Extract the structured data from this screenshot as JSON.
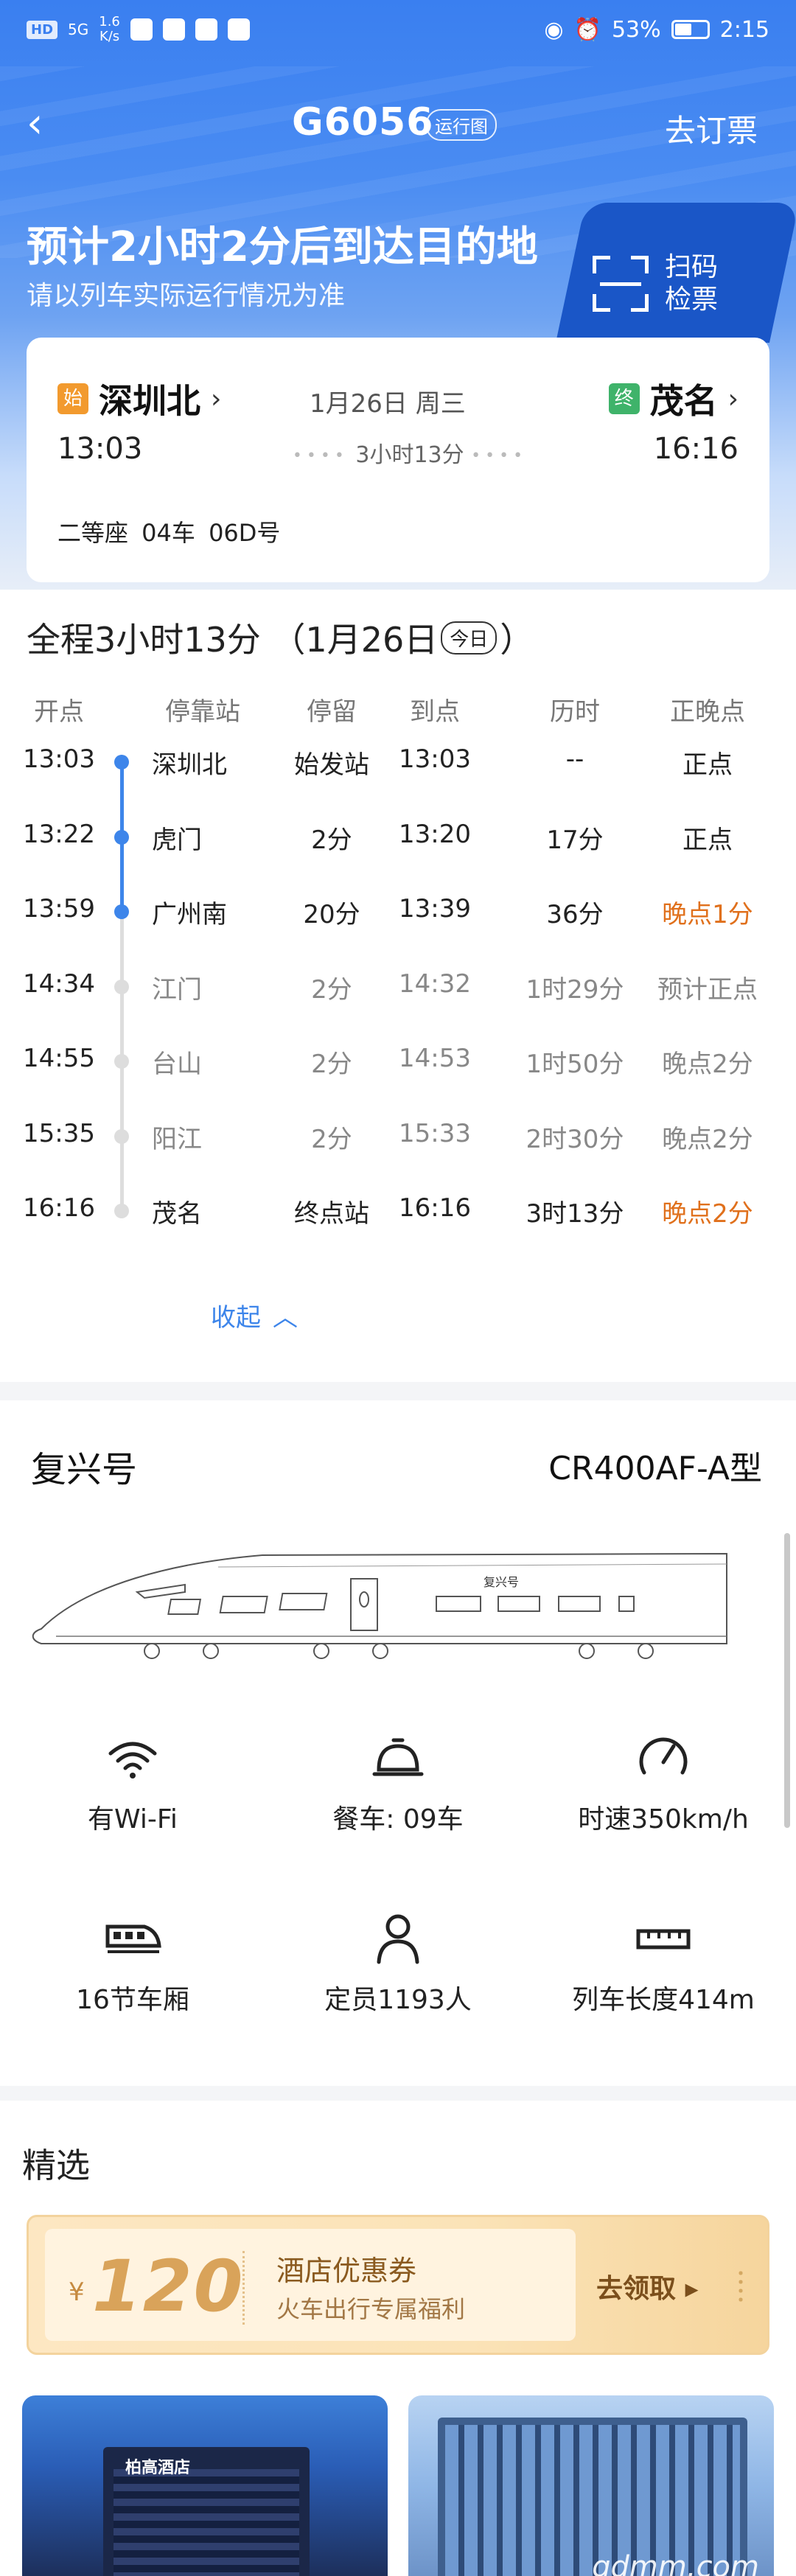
{
  "status_bar": {
    "network": "HD",
    "signal": "5G",
    "speed_value": "1.6",
    "speed_unit": "K/s",
    "battery": "53%",
    "battery_level": 0.53,
    "time": "2:15"
  },
  "nav": {
    "train_no": "G6056",
    "map_tag": "运行图",
    "order_link": "去订票"
  },
  "eta": {
    "title": "预计2小时2分后到达目的地",
    "subtitle": "请以列车实际运行情况为准",
    "scan_line1": "扫码",
    "scan_line2": "检票"
  },
  "trip": {
    "from_badge": "始",
    "from_name": "深圳北",
    "to_badge": "终",
    "to_name": "茂名",
    "date": "1月26日 周三",
    "depart_time": "13:03",
    "arrive_time": "16:16",
    "duration": "3小时13分",
    "seat": "二等座 04车 06D号"
  },
  "timetable": {
    "summary_prefix": "全程3小时13分 （1月26日",
    "today_tag": "今日",
    "summary_suffix": "）",
    "headers": [
      "开点",
      "停靠站",
      "停留",
      "到点",
      "历时",
      "正晚点"
    ],
    "rows": [
      {
        "depart": "13:03",
        "station": "深圳北",
        "stay": "始发站",
        "arrive": "13:03",
        "elapsed": "--",
        "status": "正点",
        "passed": true,
        "late": false
      },
      {
        "depart": "13:22",
        "station": "虎门",
        "stay": "2分",
        "arrive": "13:20",
        "elapsed": "17分",
        "status": "正点",
        "passed": true,
        "late": false
      },
      {
        "depart": "13:59",
        "station": "广州南",
        "stay": "20分",
        "arrive": "13:39",
        "elapsed": "36分",
        "status": "晚点1分",
        "passed": true,
        "late": true
      },
      {
        "depart": "14:34",
        "station": "江门",
        "stay": "2分",
        "arrive": "14:32",
        "elapsed": "1时29分",
        "status": "预计正点",
        "passed": false,
        "late": false
      },
      {
        "depart": "14:55",
        "station": "台山",
        "stay": "2分",
        "arrive": "14:53",
        "elapsed": "1时50分",
        "status": "晚点2分",
        "passed": false,
        "late": false
      },
      {
        "depart": "15:35",
        "station": "阳江",
        "stay": "2分",
        "arrive": "15:33",
        "elapsed": "2时30分",
        "status": "晚点2分",
        "passed": false,
        "late": false
      },
      {
        "depart": "16:16",
        "station": "茂名",
        "stay": "终点站",
        "arrive": "16:16",
        "elapsed": "3时13分",
        "status": "晚点2分",
        "passed": false,
        "late": true
      }
    ],
    "collapse_label": "收起"
  },
  "train_info": {
    "name": "复兴号",
    "model": "CR400AF-A型",
    "car_logo": "复兴号",
    "features": [
      {
        "icon": "wifi-icon",
        "label": "有Wi-Fi"
      },
      {
        "icon": "dining-bell-icon",
        "label": "餐车: 09车"
      },
      {
        "icon": "speedometer-icon",
        "label": "时速350km/h"
      },
      {
        "icon": "train-car-icon",
        "label": "16节车厢"
      },
      {
        "icon": "person-icon",
        "label": "定员1193人"
      },
      {
        "icon": "ruler-icon",
        "label": "列车长度414m"
      }
    ]
  },
  "featured": {
    "title": "精选",
    "coupon": {
      "currency": "¥",
      "amount": "120",
      "title": "酒店优惠券",
      "subtitle": "火车出行专属福利",
      "claim": "去领取"
    },
    "hotel1_sign": "柏高酒店"
  },
  "watermark": "gdmm.com",
  "colors": {
    "accent": "#3d85ea",
    "late": "#e0701c",
    "header_blue": "#3a7ff0",
    "from_badge": "#f29a2e",
    "to_badge": "#3fb36a"
  }
}
